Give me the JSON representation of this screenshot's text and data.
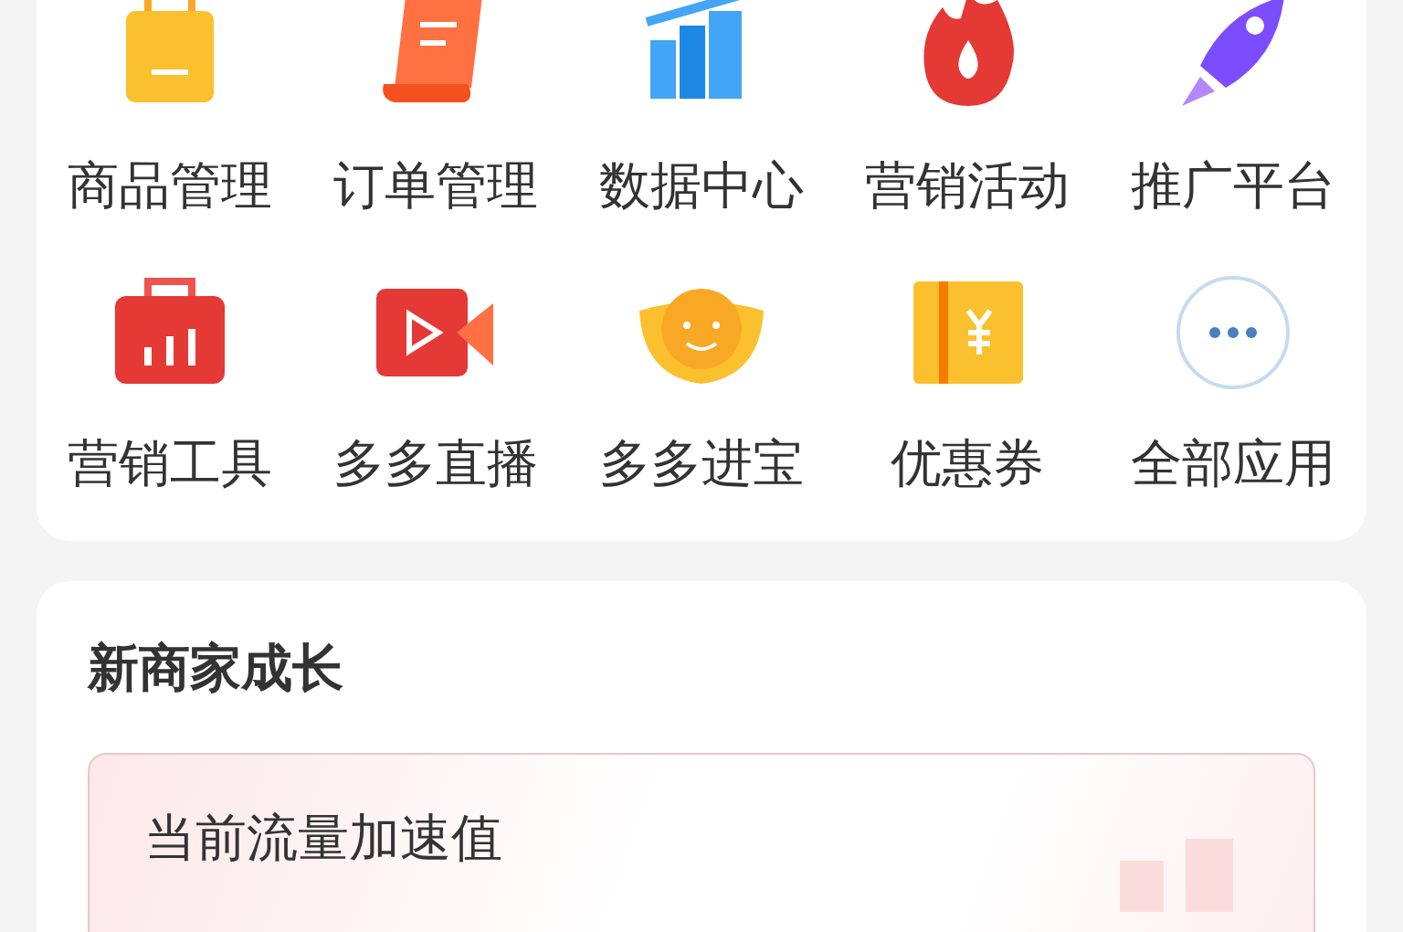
{
  "apps": [
    {
      "label": "商品管理",
      "kind": "bag"
    },
    {
      "label": "订单管理",
      "kind": "scroll"
    },
    {
      "label": "数据中心",
      "kind": "chart"
    },
    {
      "label": "营销活动",
      "kind": "flame"
    },
    {
      "label": "推广平台",
      "kind": "rocket"
    },
    {
      "label": "营销工具",
      "kind": "toolbox"
    },
    {
      "label": "多多直播",
      "kind": "video"
    },
    {
      "label": "多多进宝",
      "kind": "ingot"
    },
    {
      "label": "优惠券",
      "kind": "coupon"
    },
    {
      "label": "全部应用",
      "kind": "more"
    }
  ],
  "growth": {
    "title": "新商家成长",
    "card": {
      "label": "当前流量加速值"
    }
  }
}
